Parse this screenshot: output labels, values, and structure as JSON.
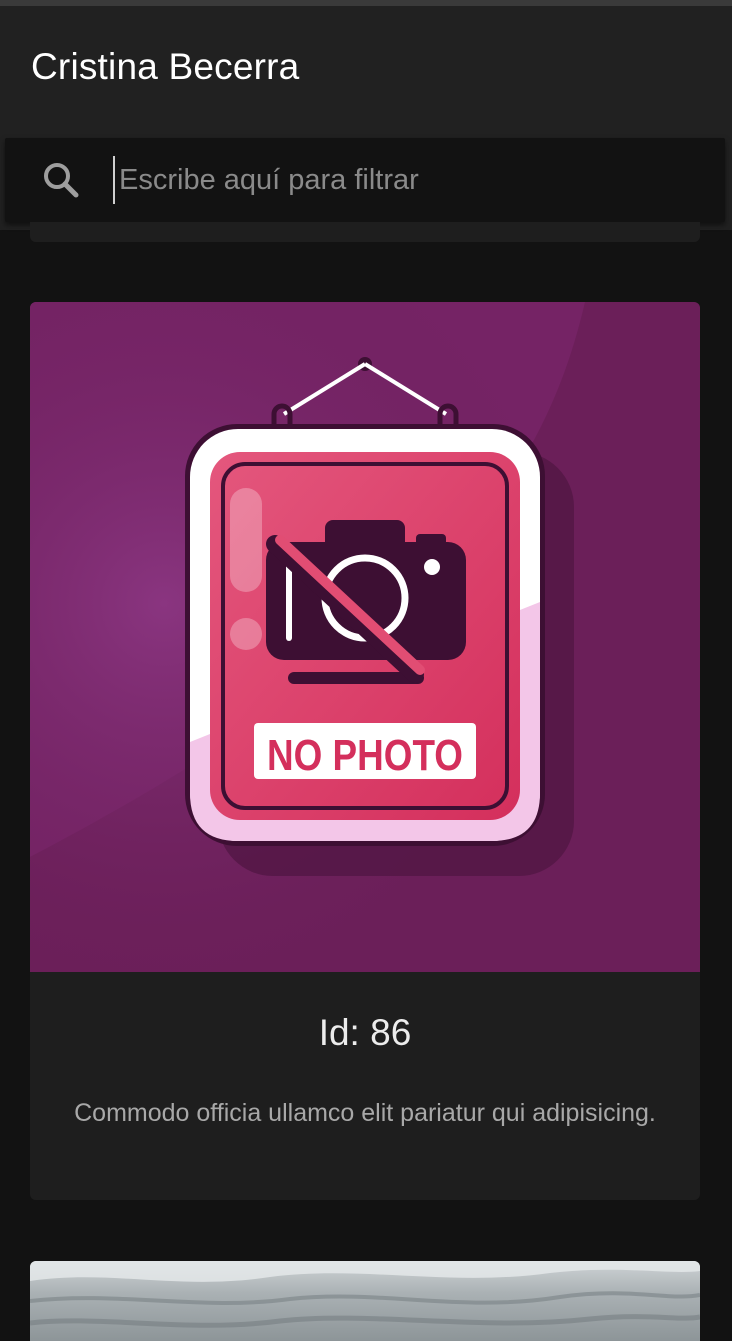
{
  "header": {
    "title": "Cristina Becerra"
  },
  "search": {
    "placeholder": "Escribe aquí para filtrar",
    "value": "",
    "icon": "search-icon"
  },
  "cards": [
    {
      "image": {
        "icon": "no-photo-sign-icon",
        "label": "NO PHOTO",
        "background": "#6b1f59"
      },
      "id_label": "Id: 86",
      "description": "Commodo officia ullamco elit pariatur qui adipisicing."
    }
  ],
  "colors": {
    "background": "#121212",
    "header": "#212121",
    "card": "#1e1e1e",
    "accent": "#d83a63"
  }
}
